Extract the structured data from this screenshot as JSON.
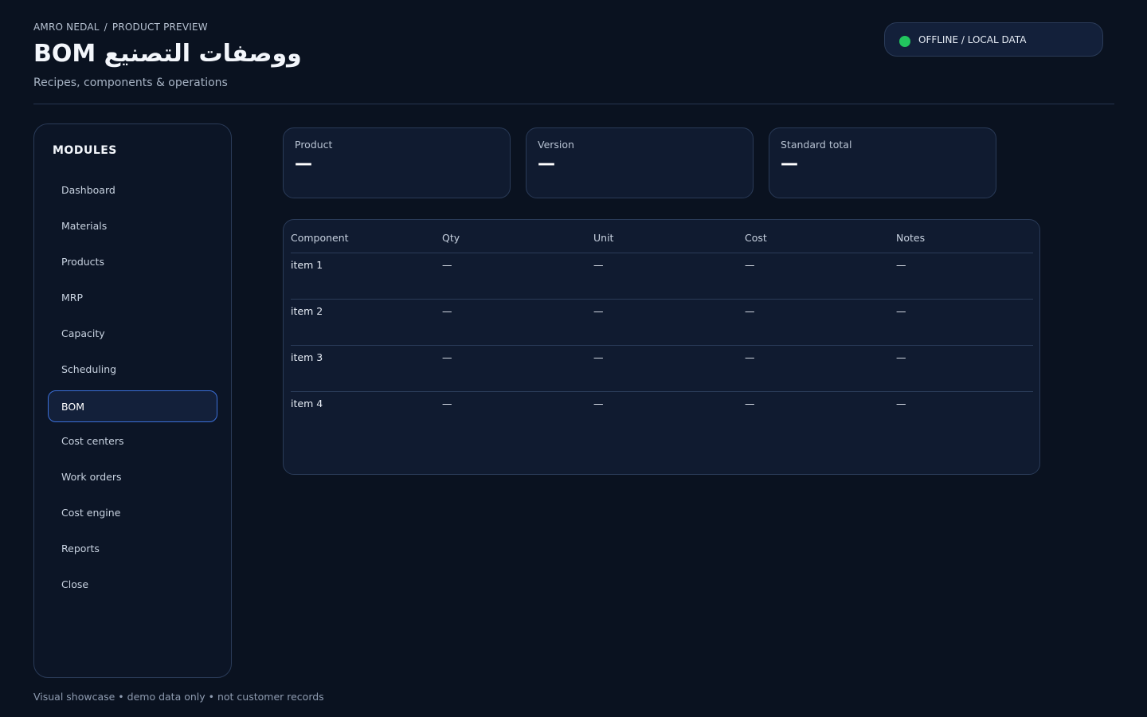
{
  "header": {
    "breadcrumb": [
      "AMRO NEDAL",
      "PRODUCT PREVIEW"
    ],
    "breadcrumb_separator": "/",
    "title": "BOM ووصفات التصنيع",
    "subtitle": "Recipes, components & operations"
  },
  "status": {
    "label": "OFFLINE / LOCAL DATA",
    "dot_color": "#22c55e"
  },
  "sidebar": {
    "heading": "MODULES",
    "items": [
      {
        "label": "Dashboard"
      },
      {
        "label": "Materials"
      },
      {
        "label": "Products"
      },
      {
        "label": "MRP"
      },
      {
        "label": "Capacity"
      },
      {
        "label": "Scheduling"
      },
      {
        "label": "BOM",
        "active": true
      },
      {
        "label": "Cost centers"
      },
      {
        "label": "Work orders"
      },
      {
        "label": "Cost engine"
      },
      {
        "label": "Reports"
      },
      {
        "label": "Close"
      }
    ]
  },
  "stats": [
    {
      "label": "Product",
      "value": "—"
    },
    {
      "label": "Version",
      "value": "—"
    },
    {
      "label": "Standard total",
      "value": "—"
    }
  ],
  "table": {
    "columns": [
      "Component",
      "Qty",
      "Unit",
      "Cost",
      "Notes"
    ],
    "rows": [
      [
        "item 1",
        "—",
        "—",
        "—",
        "—"
      ],
      [
        "item 2",
        "—",
        "—",
        "—",
        "—"
      ],
      [
        "item 3",
        "—",
        "—",
        "—",
        "—"
      ],
      [
        "item 4",
        "—",
        "—",
        "—",
        "—"
      ]
    ]
  },
  "footer": {
    "note": "Visual showcase • demo data only • not customer records"
  },
  "colors": {
    "background": "#0a1220",
    "panel": "#101b30",
    "border": "#2a3b58",
    "accent": "#3b6fd8",
    "status_online": "#22c55e"
  }
}
